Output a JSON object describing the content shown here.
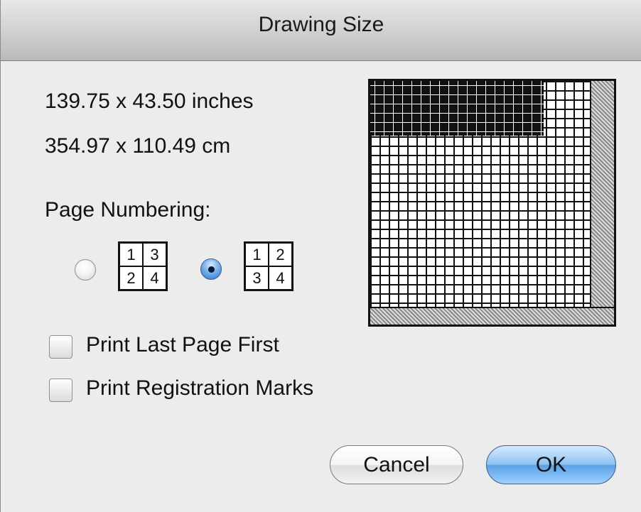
{
  "window": {
    "title": "Drawing Size"
  },
  "size_info": {
    "inches": "139.75 x 43.50 inches",
    "cm": "354.97 x 110.49 cm"
  },
  "page_numbering": {
    "label": "Page Numbering:",
    "options": [
      {
        "cells": [
          "1",
          "3",
          "2",
          "4"
        ],
        "selected": false
      },
      {
        "cells": [
          "1",
          "2",
          "3",
          "4"
        ],
        "selected": true
      }
    ]
  },
  "checkboxes": [
    {
      "label": "Print Last Page First",
      "checked": false
    },
    {
      "label": "Print Registration Marks",
      "checked": false
    }
  ],
  "buttons": {
    "cancel": "Cancel",
    "ok": "OK"
  },
  "colors": {
    "default_button": "#5aa2e6",
    "selected_radio": "#2d76c9"
  }
}
